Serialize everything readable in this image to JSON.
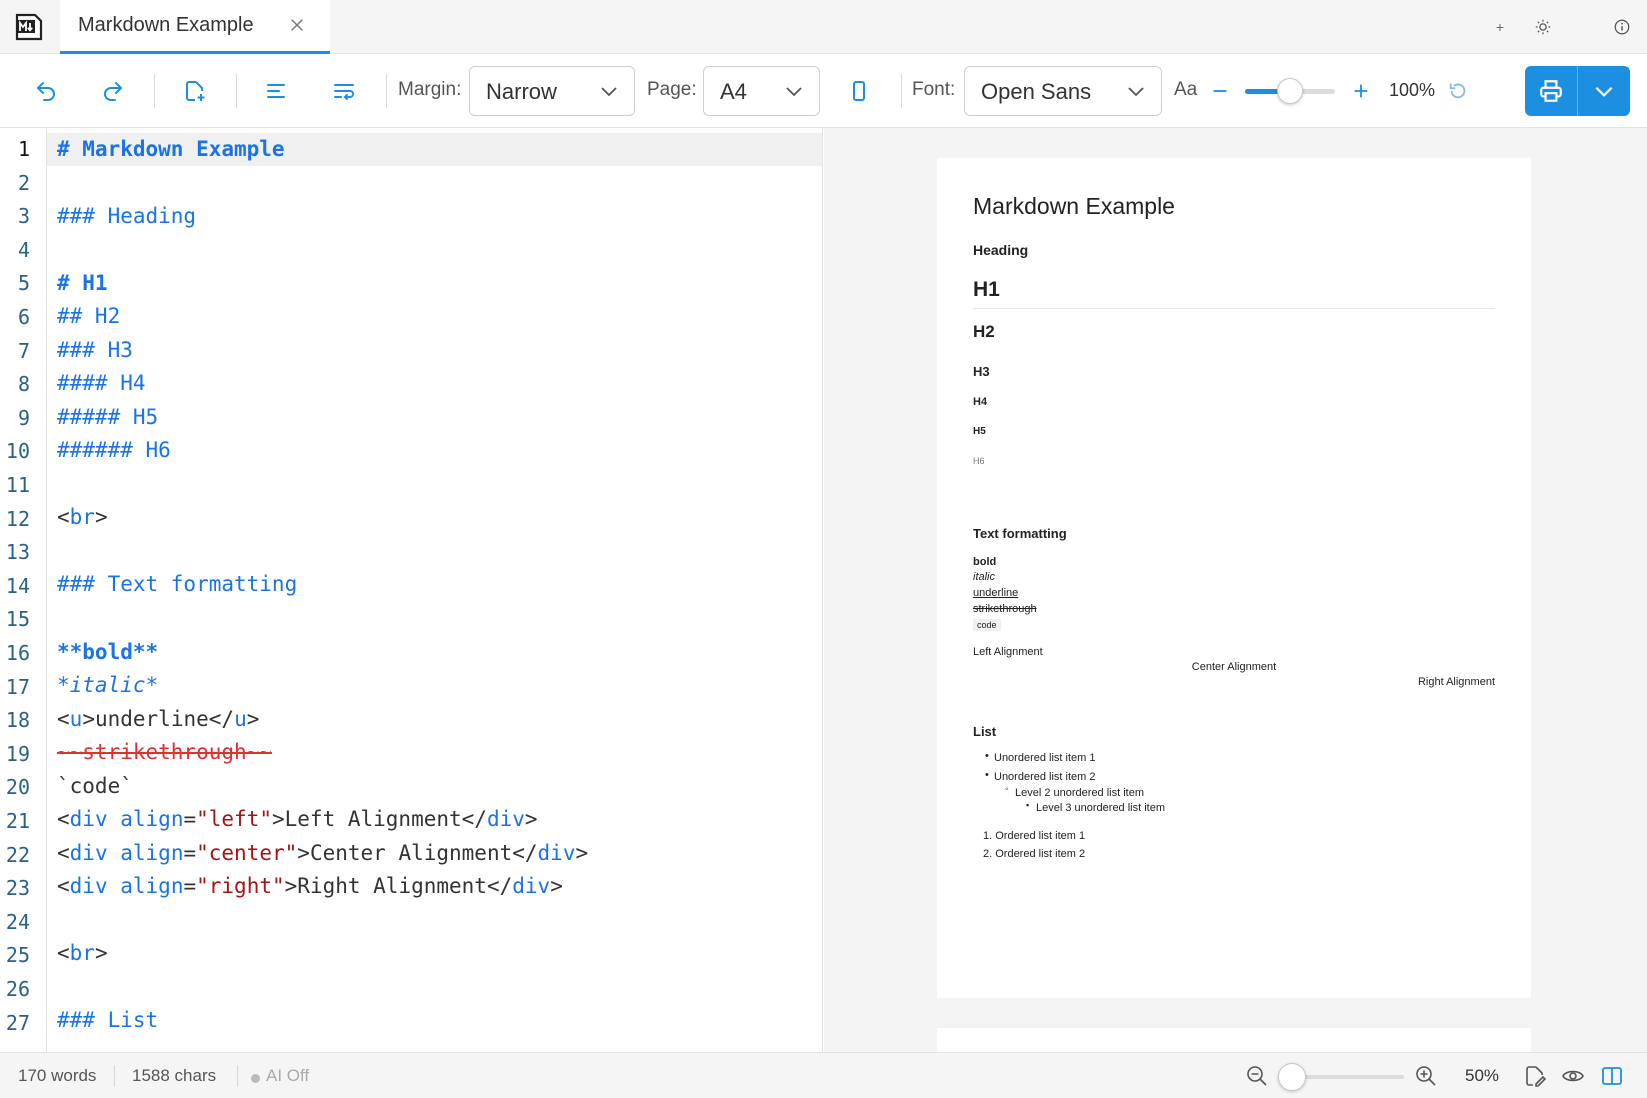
{
  "tab": {
    "title": "Markdown Example"
  },
  "titlebar": {
    "new_tab_glyph": "+"
  },
  "toolbar": {
    "margin_label": "Margin:",
    "margin_value": "Narrow",
    "page_label": "Page:",
    "page_value": "A4",
    "font_label": "Font:",
    "font_value": "Open Sans",
    "font_size_glyph": "Aa",
    "zoom_value": "100%",
    "zoom_fraction": 0.5
  },
  "editor": {
    "active_line": 1,
    "line_numbers": [
      "1",
      "2",
      "3",
      "4",
      "5",
      "6",
      "7",
      "8",
      "9",
      "10",
      "11",
      "12",
      "13",
      "14",
      "15",
      "16",
      "17",
      "18",
      "19",
      "20",
      "21",
      "22",
      "23",
      "24",
      "25",
      "26",
      "27"
    ],
    "code": {
      "l1": "# Markdown Example",
      "l3": "### Heading",
      "l5": "# H1",
      "l6": "## H2",
      "l7": "### H3",
      "l8": "#### H4",
      "l9": "##### H5",
      "l10": "###### H6",
      "br_open": "<",
      "br_tag": "br",
      "br_close": ">",
      "l14": "### Text formatting",
      "l16": "**bold**",
      "l17": "*italic*",
      "l18": {
        "lt1": "<",
        "tag1": "u",
        "gt1": ">",
        "text": "underline",
        "lt2": "</",
        "tag2": "u",
        "gt2": ">"
      },
      "l19": "~~strikethrough~~",
      "l20": "`code`",
      "div_lt": "<",
      "div_tag": "div",
      "div_sp": " ",
      "div_attr": "align",
      "div_eq": "=",
      "div_close_lt": "</",
      "div_gt": ">",
      "l21": {
        "value": "\"left\"",
        "text": "Left Alignment"
      },
      "l22": {
        "value": "\"center\"",
        "text": "Center Alignment"
      },
      "l23": {
        "value": "\"right\"",
        "text": "Right Alignment"
      },
      "l27": "### List"
    }
  },
  "preview": {
    "title": "Markdown Example",
    "heading": "Heading",
    "h1": "H1",
    "h2": "H2",
    "h3": "H3",
    "h4": "H4",
    "h5": "H5",
    "h6": "H6",
    "text_formatting": "Text formatting",
    "bold": "bold",
    "italic": "italic",
    "underline": "underline",
    "strikethrough": "strikethrough",
    "code": "code",
    "left_alignment": "Left Alignment",
    "center_alignment": "Center Alignment",
    "right_alignment": "Right Alignment",
    "list_heading": "List",
    "ul_item1": "Unordered list item 1",
    "ul_item2": "Unordered list item 2",
    "ul_level2": "Level 2 unordered list item",
    "ul_level3": "Level 3 unordered list item",
    "ol_item1": "1. Ordered list item 1",
    "ol_item2": "2. Ordered list item 2"
  },
  "status": {
    "words": "170 words",
    "chars": "1588 chars",
    "ai": "AI Off",
    "preview_zoom": "50%",
    "preview_zoom_fraction": 0.0
  },
  "colors": {
    "accent": "#1c8fe0",
    "syntax_blue": "#1a73e8",
    "syntax_red": "#a31515",
    "strike_red": "#e03131"
  },
  "icons": [
    "markdown-logo-icon",
    "close-icon",
    "plus-icon",
    "sun-icon",
    "info-icon",
    "undo-icon",
    "redo-icon",
    "new-file-icon",
    "align-left-icon",
    "wrap-text-icon",
    "chevron-down-icon",
    "portrait-orientation-icon",
    "minus-icon",
    "reset-icon",
    "printer-icon",
    "zoom-out-icon",
    "zoom-in-icon",
    "edit-file-icon",
    "eye-icon",
    "split-view-icon"
  ]
}
